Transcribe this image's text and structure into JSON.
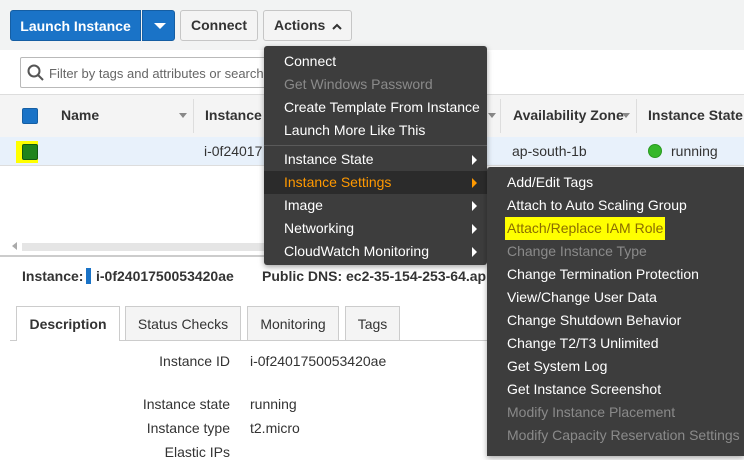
{
  "toolbar": {
    "launch_label": "Launch Instance",
    "connect_label": "Connect",
    "actions_label": "Actions"
  },
  "filter": {
    "placeholder": "Filter by tags and attributes or search"
  },
  "table": {
    "columns": [
      "Name",
      "Instance I",
      "Availability Zone",
      "Instance State"
    ],
    "row": {
      "instance_id": "i-0f24017",
      "availability_zone": "ap-south-1b",
      "state": "running"
    }
  },
  "details": {
    "instance_label": "Instance:",
    "instance_id": "i-0f2401750053420ae",
    "dns_label": "Public DNS:",
    "dns_value": "ec2-35-154-253-64.ap"
  },
  "tabs": [
    "Description",
    "Status Checks",
    "Monitoring",
    "Tags"
  ],
  "description": [
    {
      "key": "Instance ID",
      "value": "i-0f2401750053420ae"
    },
    {
      "key": "Instance state",
      "value": "running"
    },
    {
      "key": "Instance type",
      "value": "t2.micro"
    },
    {
      "key": "Elastic IPs",
      "value": ""
    }
  ],
  "actions_menu": [
    {
      "label": "Connect",
      "state": "enabled"
    },
    {
      "label": "Get Windows Password",
      "state": "disabled"
    },
    {
      "label": "Create Template From Instance",
      "state": "enabled"
    },
    {
      "label": "Launch More Like This",
      "state": "enabled"
    },
    {
      "label": "Instance State",
      "state": "enabled"
    },
    {
      "label": "Instance Settings",
      "state": "active"
    },
    {
      "label": "Image",
      "state": "enabled"
    },
    {
      "label": "Networking",
      "state": "enabled"
    },
    {
      "label": "CloudWatch Monitoring",
      "state": "enabled"
    }
  ],
  "settings_menu": [
    {
      "label": "Add/Edit Tags",
      "state": "enabled"
    },
    {
      "label": "Attach to Auto Scaling Group",
      "state": "enabled"
    },
    {
      "label": "Attach/Replace IAM Role",
      "state": "highlighted"
    },
    {
      "label": "Change Instance Type",
      "state": "disabled"
    },
    {
      "label": "Change Termination Protection",
      "state": "enabled"
    },
    {
      "label": "View/Change User Data",
      "state": "enabled"
    },
    {
      "label": "Change Shutdown Behavior",
      "state": "enabled"
    },
    {
      "label": "Change T2/T3 Unlimited",
      "state": "enabled"
    },
    {
      "label": "Get System Log",
      "state": "enabled"
    },
    {
      "label": "Get Instance Screenshot",
      "state": "enabled"
    },
    {
      "label": "Modify Instance Placement",
      "state": "disabled"
    },
    {
      "label": "Modify Capacity Reservation Settings",
      "state": "disabled"
    }
  ],
  "colors": {
    "primary": "#1a73c7",
    "menu_bg": "#3d3d3d",
    "menu_active": "#ff9900",
    "highlight": "#ffff00",
    "running": "#36b82a"
  }
}
